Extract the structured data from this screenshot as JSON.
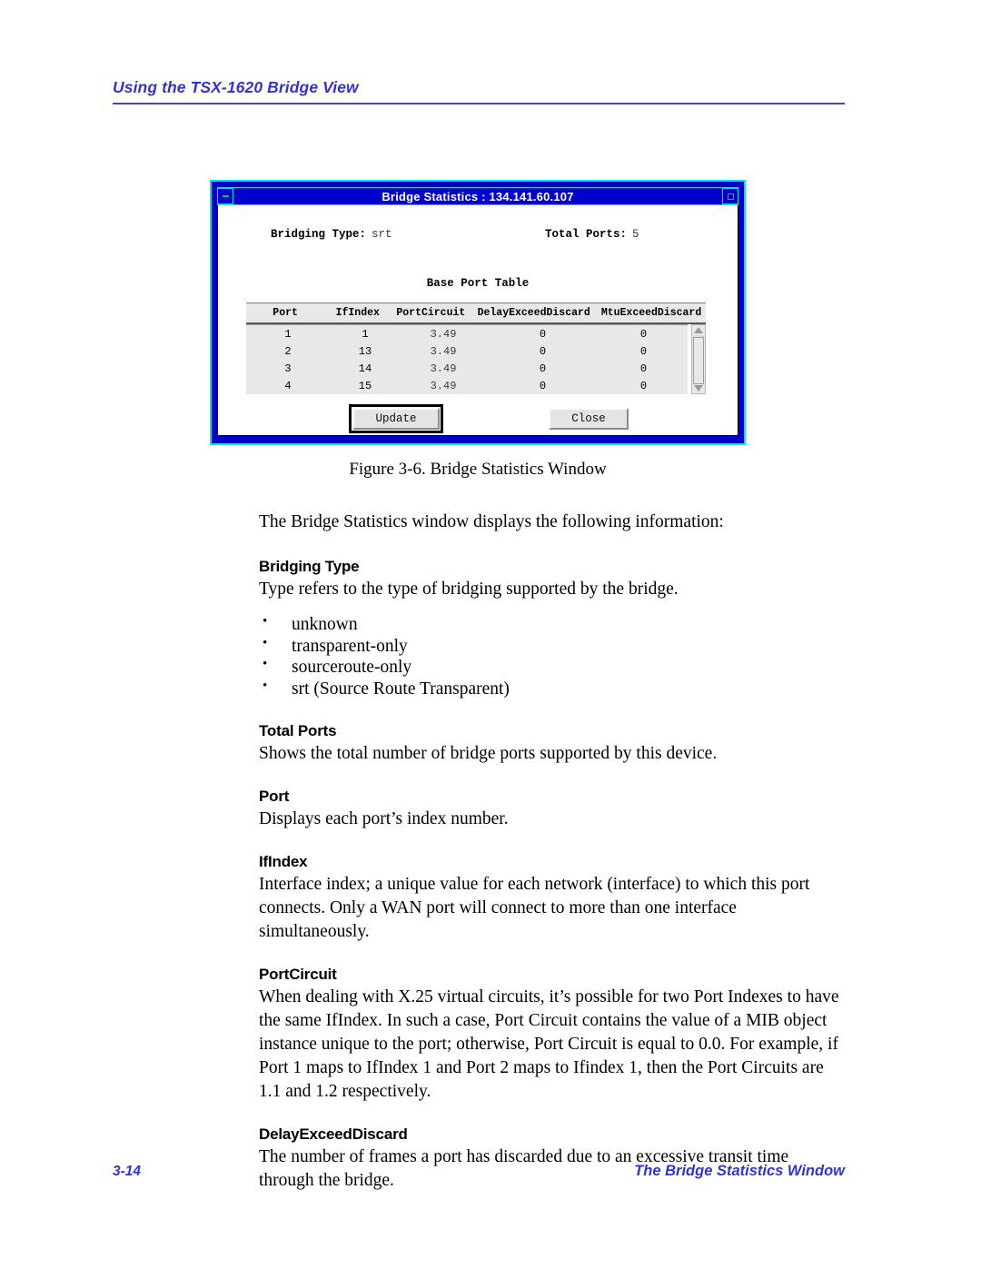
{
  "header": {
    "running_head": "Using the TSX-1620 Bridge View"
  },
  "figure": {
    "caption": "Figure 3-6.  Bridge Statistics Window",
    "dialog": {
      "title": "Bridge Statistics : 134.141.60.107",
      "minimize_icon": "minimize-icon",
      "maximize_icon": "maximize-icon",
      "summary": {
        "bridging_type_label": "Bridging Type:",
        "bridging_type_value": "srt",
        "total_ports_label": "Total Ports:",
        "total_ports_value": "5"
      },
      "table_title": "Base Port Table",
      "columns": [
        "Port",
        "IfIndex",
        "PortCircuit",
        "DelayExceedDiscard",
        "MtuExceedDiscard"
      ],
      "rows": [
        [
          "1",
          "1",
          "3.49",
          "0",
          "0"
        ],
        [
          "2",
          "13",
          "3.49",
          "0",
          "0"
        ],
        [
          "3",
          "14",
          "3.49",
          "0",
          "0"
        ],
        [
          "4",
          "15",
          "3.49",
          "0",
          "0"
        ]
      ],
      "buttons": {
        "update": "Update",
        "close": "Close"
      }
    }
  },
  "body": {
    "intro": "The Bridge Statistics window displays the following information:",
    "sections": [
      {
        "heading": "Bridging Type",
        "text": "Type refers to the type of bridging supported by the bridge.",
        "bullets": [
          "unknown",
          "transparent-only",
          "sourceroute-only",
          "srt (Source Route Transparent)"
        ]
      },
      {
        "heading": "Total Ports",
        "text": "Shows the total number of bridge ports supported by this device."
      },
      {
        "heading": "Port",
        "text": "Displays each port’s index number."
      },
      {
        "heading": "IfIndex",
        "text": "Interface index; a unique value for each network (interface) to which this port connects. Only a WAN port will connect to more than one interface simultaneously."
      },
      {
        "heading": "PortCircuit",
        "text": "When dealing with X.25 virtual circuits, it’s possible for two Port Indexes to have the same IfIndex. In such a case, Port Circuit contains the value of a MIB object instance unique to the port; otherwise, Port Circuit is equal to 0.0. For example, if Port 1 maps to IfIndex 1 and Port 2 maps to Ifindex 1, then the Port Circuits are 1.1 and 1.2 respectively."
      },
      {
        "heading": "DelayExceedDiscard",
        "text": "The number of frames a port has discarded due to an excessive transit time through the bridge."
      }
    ]
  },
  "footer": {
    "page_number": "3-14",
    "section_title": "The Bridge Statistics Window"
  },
  "colors": {
    "accent_blue": "#3333cc",
    "titlebar_blue": "#0000cc",
    "window_border_cyan": "#00e5e5"
  }
}
